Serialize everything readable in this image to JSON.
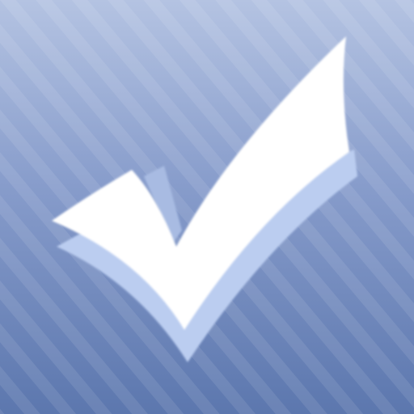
{
  "icon": {
    "name": "checkmark-app-icon",
    "glyph": "checkmark-icon",
    "colors": {
      "background_top": "#B4C3E2",
      "background_mid": "#879CCB",
      "background_bottom": "#5C77AE",
      "stripe": "#FFFFFF",
      "check_front": "#FFFFFF",
      "check_shadow": "#BBCDF0",
      "check_shadow_dark": "#A8BBE2"
    }
  }
}
